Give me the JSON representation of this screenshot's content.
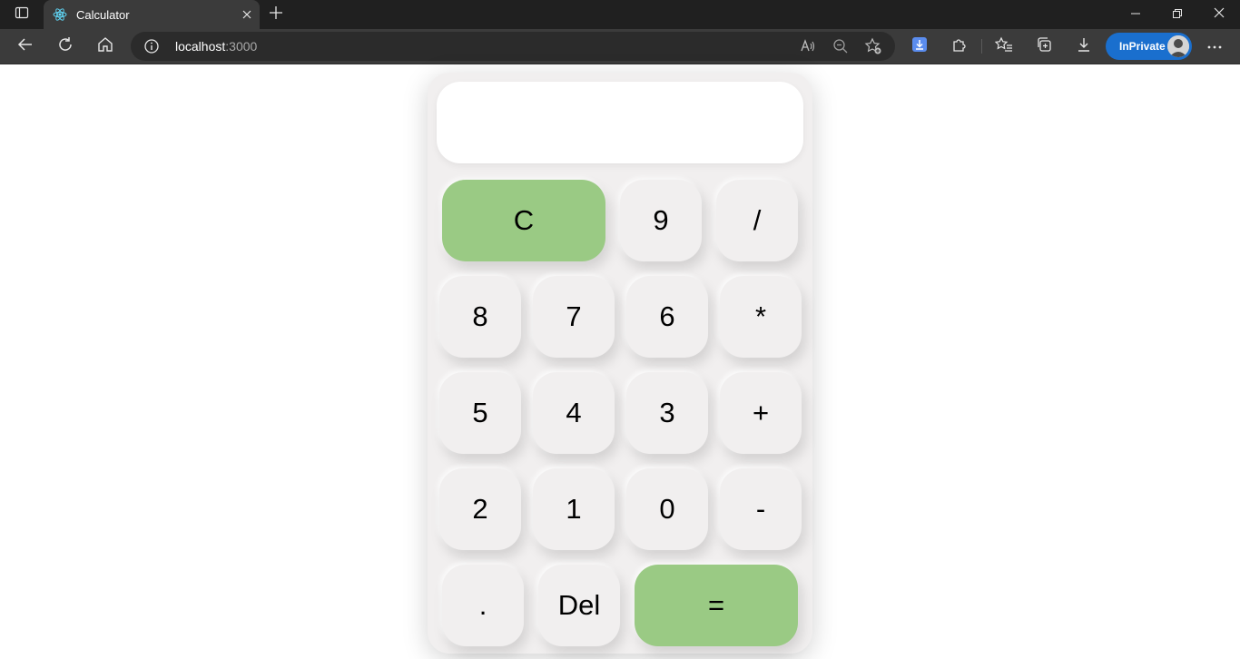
{
  "browser": {
    "tab_title": "Calculator",
    "url_host": "localhost",
    "url_port": ":3000",
    "inprivate_label": "InPrivate"
  },
  "calculator": {
    "display_value": "",
    "accent_color": "#9aca84",
    "keys": {
      "clear": "C",
      "nine": "9",
      "divide": "/",
      "eight": "8",
      "seven": "7",
      "six": "6",
      "multiply": "*",
      "five": "5",
      "four": "4",
      "three": "3",
      "plus": "+",
      "two": "2",
      "one": "1",
      "zero": "0",
      "minus": "-",
      "decimal": ".",
      "delete": "Del",
      "equals": "="
    }
  }
}
